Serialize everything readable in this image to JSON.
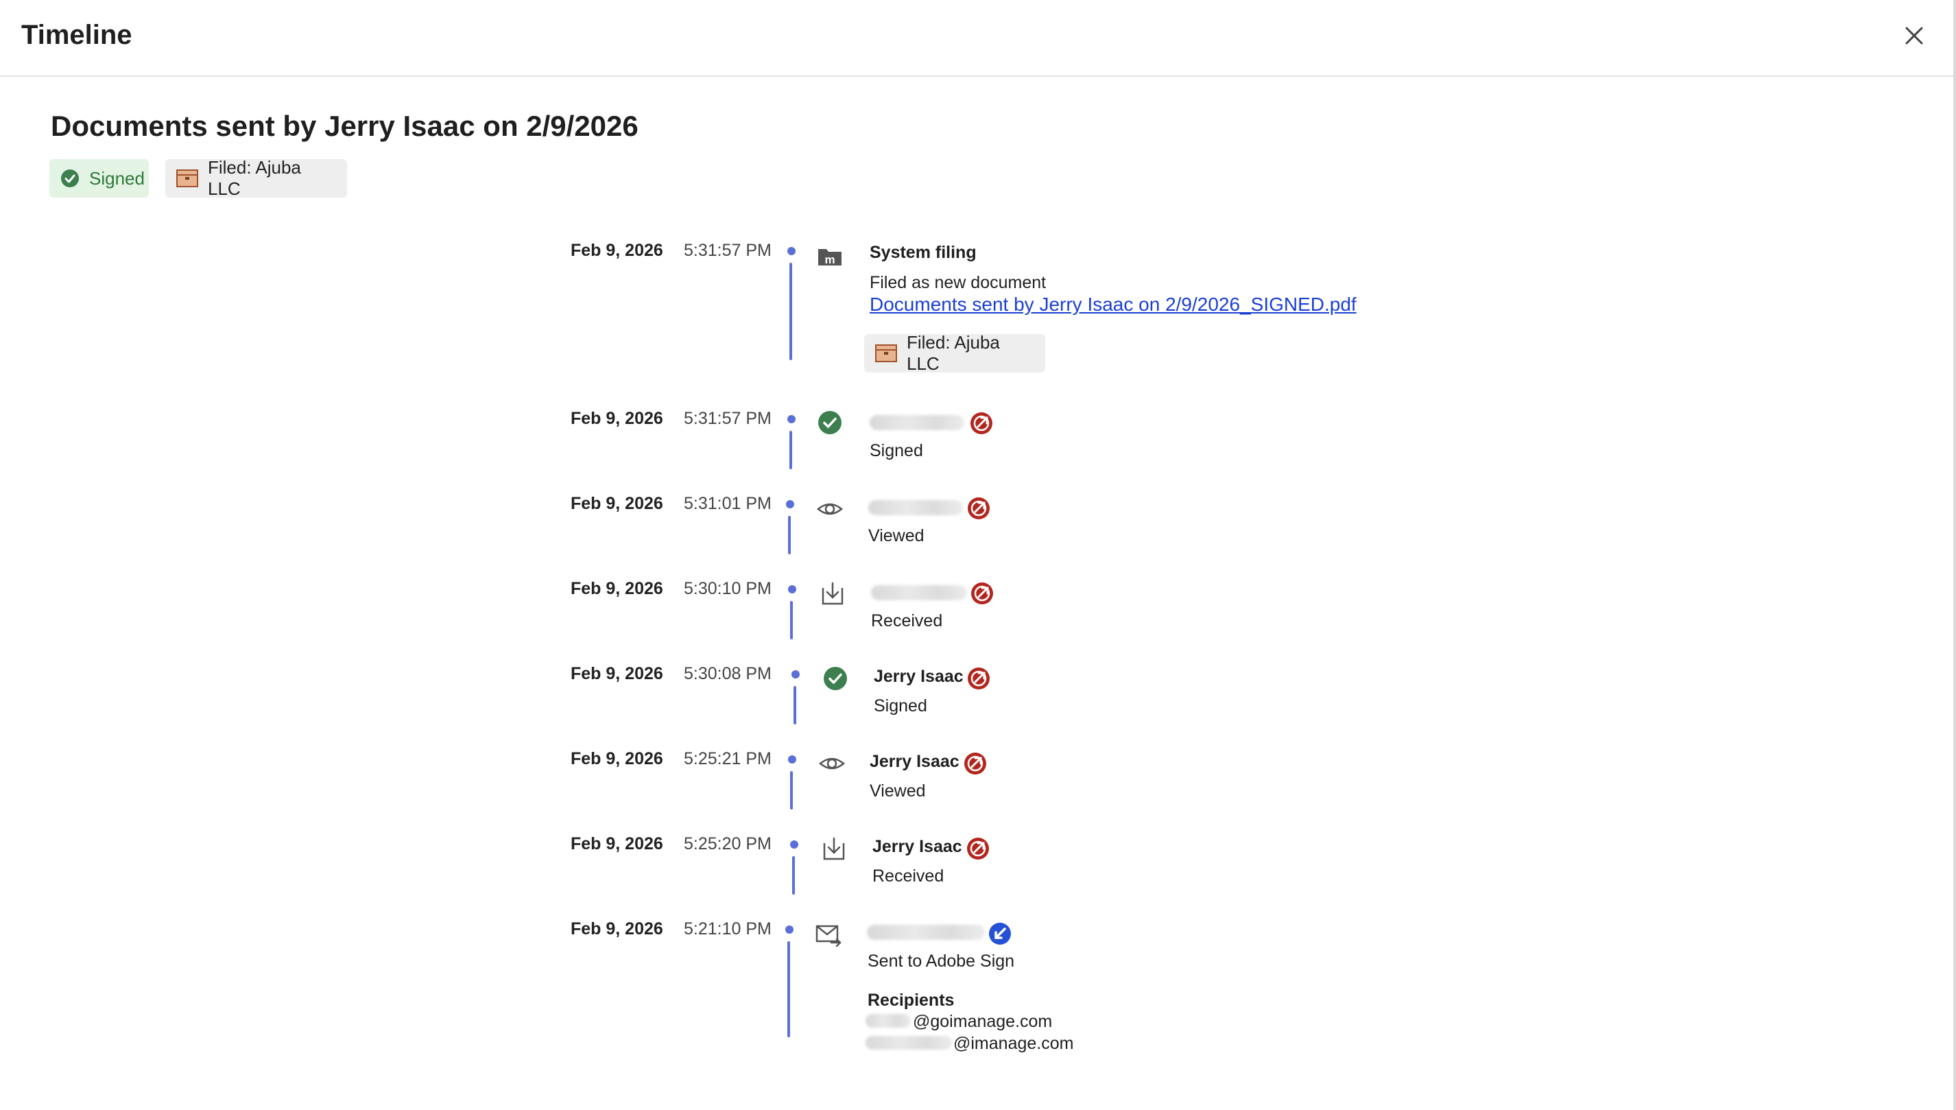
{
  "header": {
    "title": "Timeline"
  },
  "page": {
    "title": "Documents sent by Jerry Isaac on 2/9/2026"
  },
  "chips": {
    "signed": "Signed",
    "filed": "Filed: Ajuba LLC"
  },
  "colors": {
    "accent": "#5b6fd8",
    "link": "#1a3fd6",
    "signed_green": "#3d7f4e",
    "outbound_red": "#b3261e",
    "inbound_blue": "#2451d6"
  },
  "events": [
    {
      "date": "Feb 9, 2026",
      "time": "5:31:57 PM",
      "icon": "folder-m-icon",
      "title": "System filing",
      "text": "Filed as new document",
      "link": "Documents sent by Jerry Isaac on 2/9/2026_SIGNED.pdf",
      "chip": "Filed: Ajuba LLC"
    },
    {
      "date": "Feb 9, 2026",
      "time": "5:31:57 PM",
      "icon": "check-circle-icon",
      "actor": "",
      "action": "Signed",
      "badge": "outbound-arrow-icon"
    },
    {
      "date": "Feb 9, 2026",
      "time": "5:31:01 PM",
      "icon": "eye-icon",
      "actor": "",
      "action": "Viewed",
      "badge": "outbound-arrow-icon"
    },
    {
      "date": "Feb 9, 2026",
      "time": "5:30:10 PM",
      "icon": "download-tray-icon",
      "actor": "",
      "action": "Received",
      "badge": "outbound-arrow-icon"
    },
    {
      "date": "Feb 9, 2026",
      "time": "5:30:08 PM",
      "icon": "check-circle-icon",
      "actor": "Jerry Isaac",
      "action": "Signed",
      "badge": "outbound-arrow-icon"
    },
    {
      "date": "Feb 9, 2026",
      "time": "5:25:21 PM",
      "icon": "eye-icon",
      "actor": "Jerry Isaac",
      "action": "Viewed",
      "badge": "outbound-arrow-icon"
    },
    {
      "date": "Feb 9, 2026",
      "time": "5:25:20 PM",
      "icon": "download-tray-icon",
      "actor": "Jerry Isaac",
      "action": "Received",
      "badge": "outbound-arrow-icon"
    },
    {
      "date": "Feb 9, 2026",
      "time": "5:21:10 PM",
      "icon": "envelope-send-icon",
      "actor": "",
      "action": "Sent to Adobe Sign",
      "badge": "inbound-arrow-icon",
      "recipients_label": "Recipients",
      "recipients": [
        "@goimanage.com",
        "@imanage.com"
      ]
    }
  ]
}
